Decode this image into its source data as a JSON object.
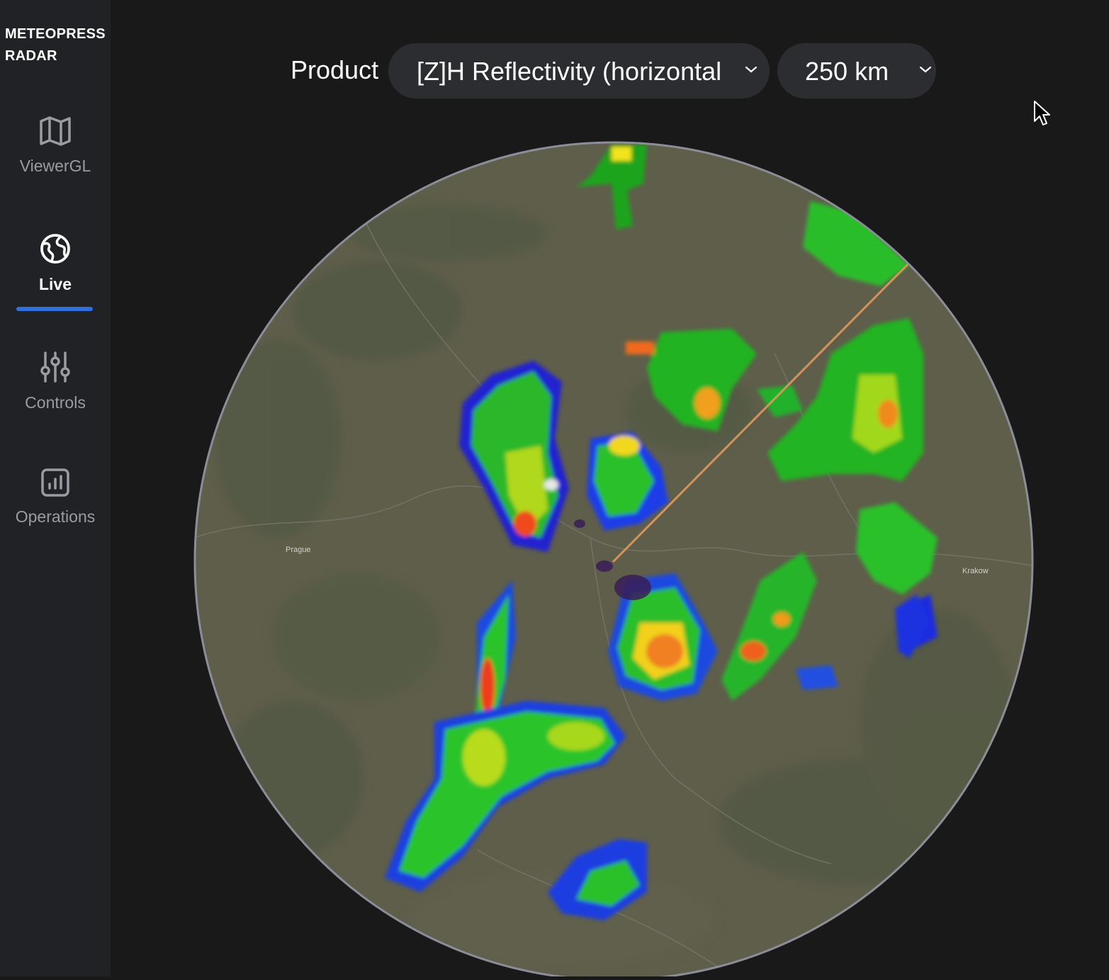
{
  "sidebar": {
    "brand_line1": "METEOPRESS",
    "brand_line2": "RADAR",
    "items": [
      {
        "label": "ViewerGL",
        "icon": "map-icon"
      },
      {
        "label": "Live",
        "icon": "globe-icon"
      },
      {
        "label": "Controls",
        "icon": "sliders-icon"
      },
      {
        "label": "Operations",
        "icon": "chart-icon"
      }
    ],
    "active": "Live"
  },
  "toolbar": {
    "product_label": "Product",
    "product_value": "[Z]H Reflectivity (horizontal",
    "range_value": "250 km"
  },
  "map": {
    "place_labels": [
      "Prague",
      "Krakow"
    ]
  },
  "colors": {
    "accent": "#2f6fe0",
    "background": "#19191a",
    "sidebar": "#212225",
    "control": "#2c2d31",
    "radar_ring": "#8b8e98",
    "beam": "#e09a5b"
  }
}
